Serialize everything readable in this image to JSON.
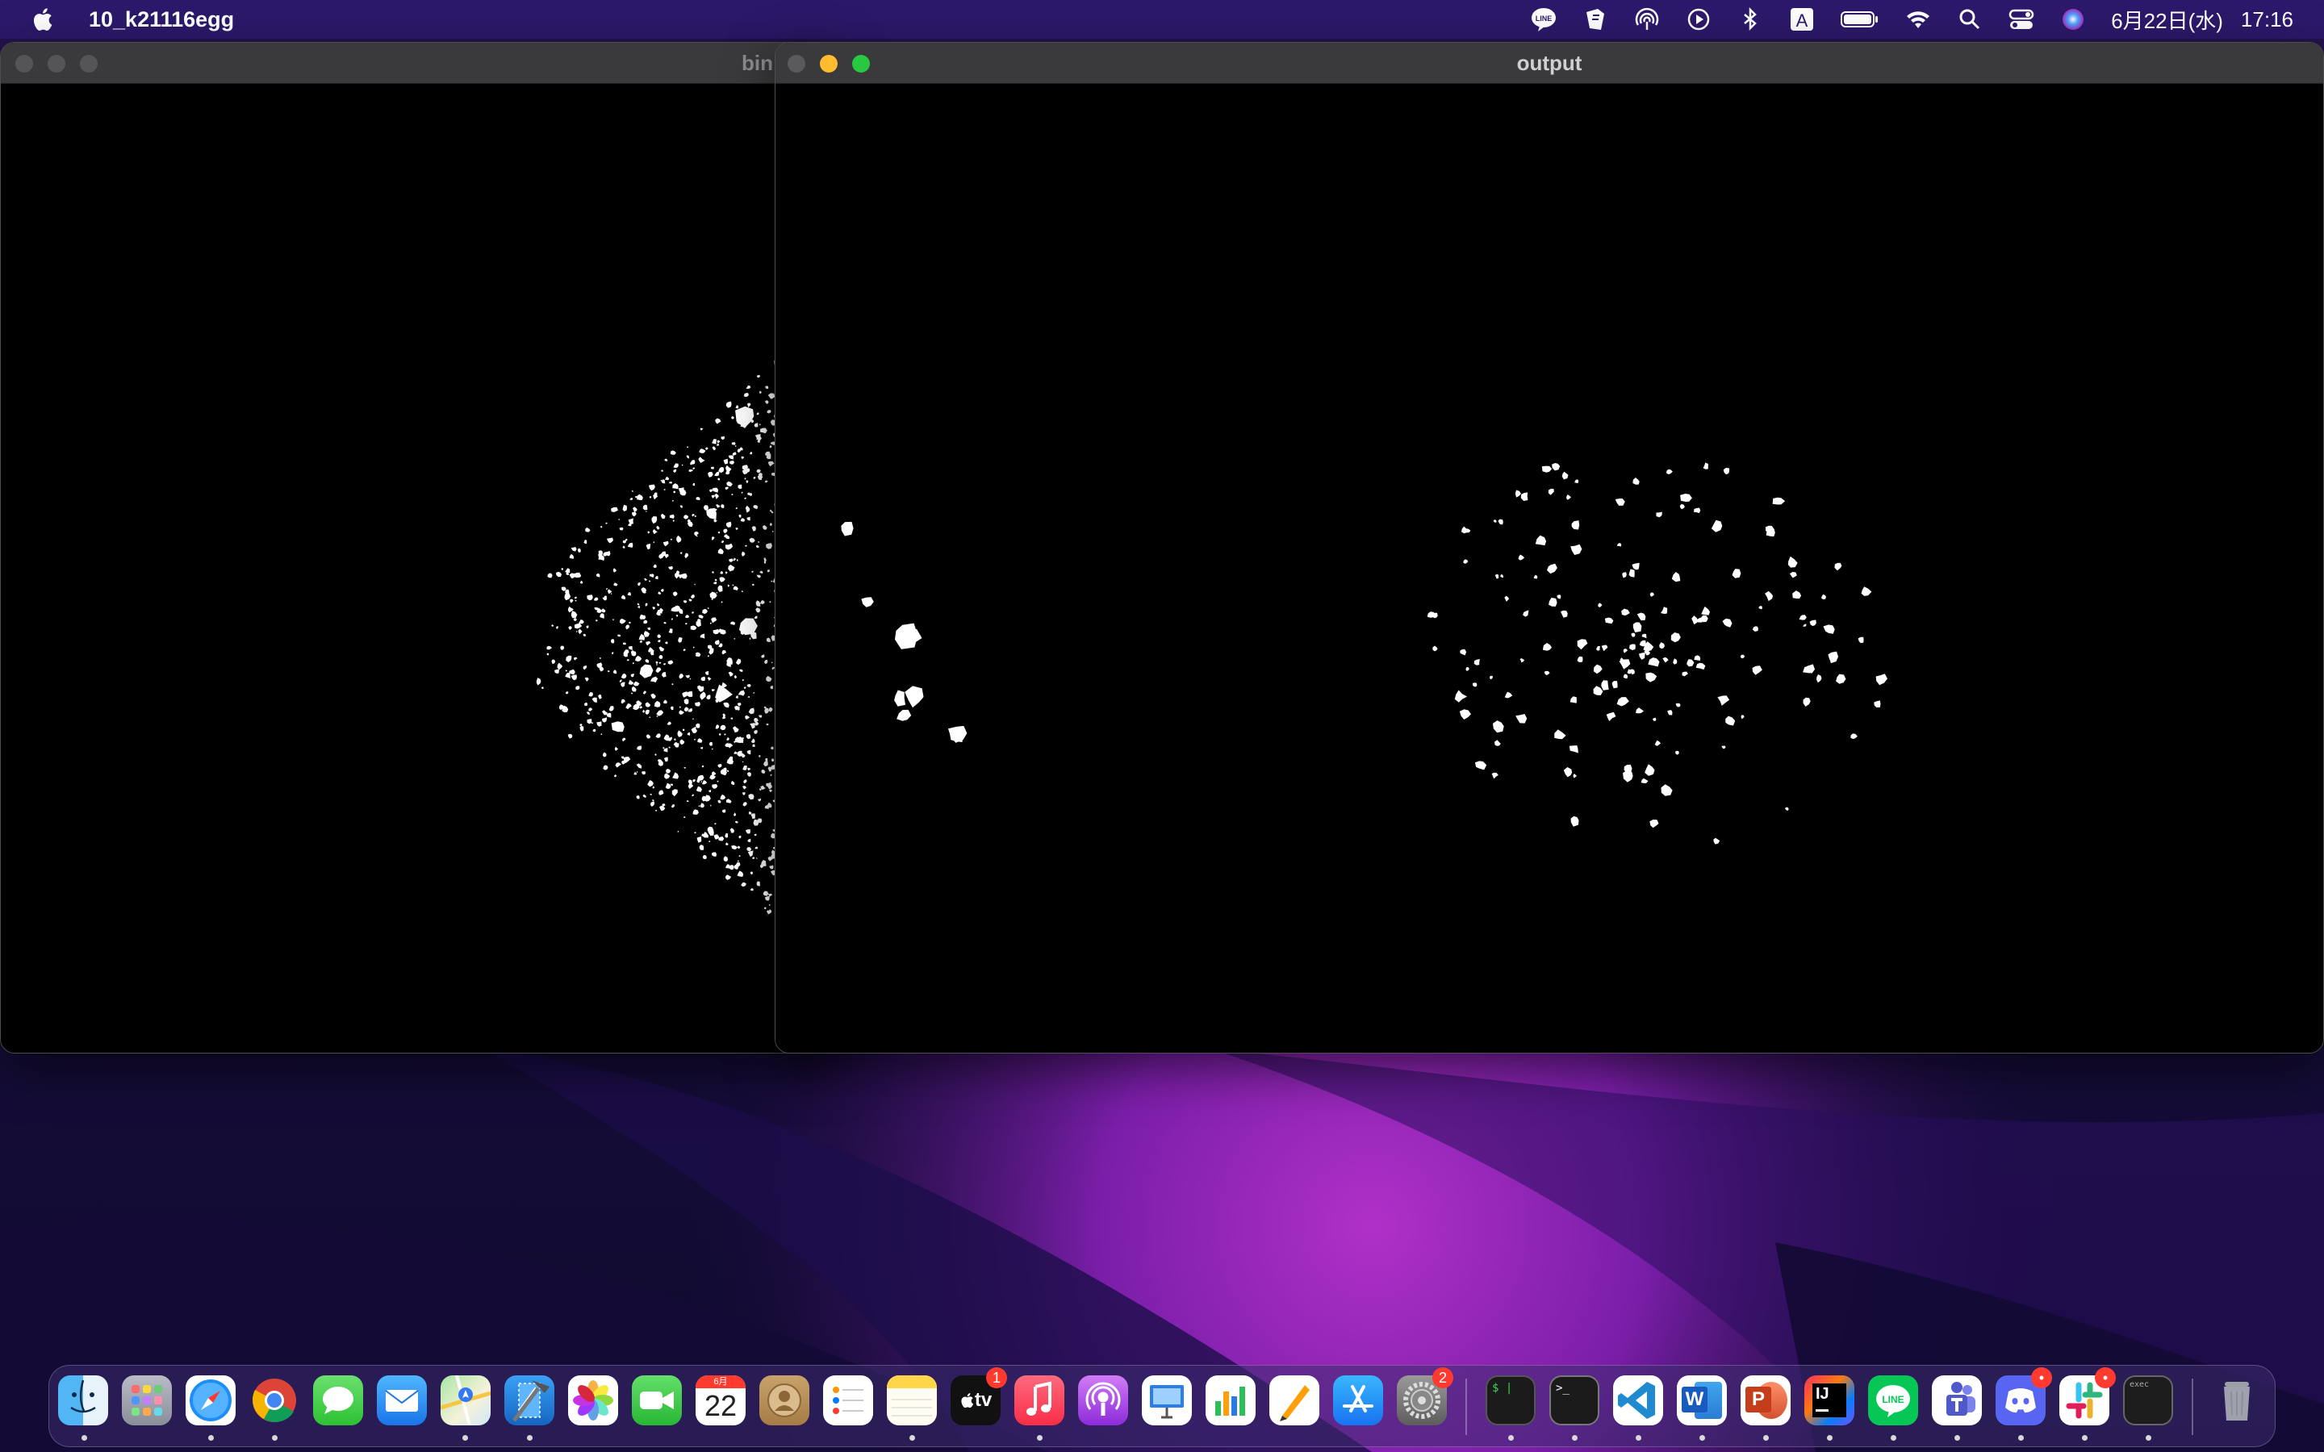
{
  "menubar": {
    "app_name": "10_k21116egg",
    "date": "6月22日(水)",
    "time": "17:16",
    "status_icons": [
      "line-icon",
      "script-icon",
      "airdrop-icon",
      "play-icon",
      "bluetooth-icon",
      "input-source-icon",
      "battery-icon",
      "wifi-icon",
      "spotlight-icon",
      "control-center-icon",
      "siri-icon"
    ],
    "input_source_label": "A",
    "line_label": "LINE"
  },
  "windows": [
    {
      "id": "bin",
      "title": "bin",
      "state": "inactive"
    },
    {
      "id": "output",
      "title": "output",
      "state": "active"
    }
  ],
  "dock": {
    "apps": [
      {
        "name": "Finder",
        "icon": "finder-icon",
        "running": true
      },
      {
        "name": "Launchpad",
        "icon": "launchpad-icon",
        "running": false
      },
      {
        "name": "Safari",
        "icon": "safari-icon",
        "running": true
      },
      {
        "name": "Google Chrome",
        "icon": "chrome-icon",
        "running": true
      },
      {
        "name": "Messages",
        "icon": "messages-icon",
        "running": false
      },
      {
        "name": "Mail",
        "icon": "mail-icon",
        "running": false
      },
      {
        "name": "Maps",
        "icon": "maps-icon",
        "running": true
      },
      {
        "name": "Xcode",
        "icon": "xcode-icon",
        "running": true
      },
      {
        "name": "Photos",
        "icon": "photos-icon",
        "running": false
      },
      {
        "name": "FaceTime",
        "icon": "facetime-icon",
        "running": false
      },
      {
        "name": "Calendar",
        "icon": "calendar-icon",
        "running": false,
        "month": "6月",
        "day": "22"
      },
      {
        "name": "Contacts",
        "icon": "contacts-icon",
        "running": false
      },
      {
        "name": "Reminders",
        "icon": "reminders-icon",
        "running": false
      },
      {
        "name": "Notes",
        "icon": "notes-icon",
        "running": true
      },
      {
        "name": "TV",
        "icon": "apple-tv-icon",
        "running": false,
        "badge": "1",
        "label": "tv"
      },
      {
        "name": "Music",
        "icon": "music-icon",
        "running": true
      },
      {
        "name": "Podcasts",
        "icon": "podcasts-icon",
        "running": false
      },
      {
        "name": "Keynote",
        "icon": "keynote-icon",
        "running": false
      },
      {
        "name": "Numbers",
        "icon": "numbers-icon",
        "running": false
      },
      {
        "name": "Pages",
        "icon": "pages-icon",
        "running": false
      },
      {
        "name": "App Store",
        "icon": "app-store-icon",
        "running": false
      },
      {
        "name": "System Preferences",
        "icon": "system-preferences-icon",
        "running": false,
        "badge": "2"
      },
      {
        "name": "Terminal",
        "icon": "terminal-dollar-icon",
        "running": true,
        "label": "$ |"
      },
      {
        "name": "Terminal",
        "icon": "terminal-icon",
        "running": true,
        "label": ">_"
      },
      {
        "name": "Visual Studio Code",
        "icon": "vscode-icon",
        "running": true
      },
      {
        "name": "Microsoft Word",
        "icon": "word-icon",
        "running": true,
        "label": "W"
      },
      {
        "name": "Microsoft PowerPoint",
        "icon": "powerpoint-icon",
        "running": true,
        "label": "P"
      },
      {
        "name": "IntelliJ IDEA",
        "icon": "intellij-icon",
        "running": true,
        "label": "IJ"
      },
      {
        "name": "LINE",
        "icon": "line-app-icon",
        "running": true,
        "label": "LINE"
      },
      {
        "name": "Microsoft Teams",
        "icon": "teams-icon",
        "running": true
      },
      {
        "name": "Discord",
        "icon": "discord-icon",
        "running": true,
        "badge": "•"
      },
      {
        "name": "Slack",
        "icon": "slack-icon",
        "running": true,
        "badge": "•"
      },
      {
        "name": "exec",
        "icon": "exec-terminal-icon",
        "running": true,
        "label": "exec"
      },
      {
        "name": "Trash",
        "icon": "trash-icon",
        "running": false
      }
    ]
  },
  "colors": {
    "menubar_bg": "#2e1a6e",
    "close": "#ff5f57",
    "minimize": "#febc2e",
    "zoom": "#28c840",
    "inactive_light": "#555555"
  }
}
